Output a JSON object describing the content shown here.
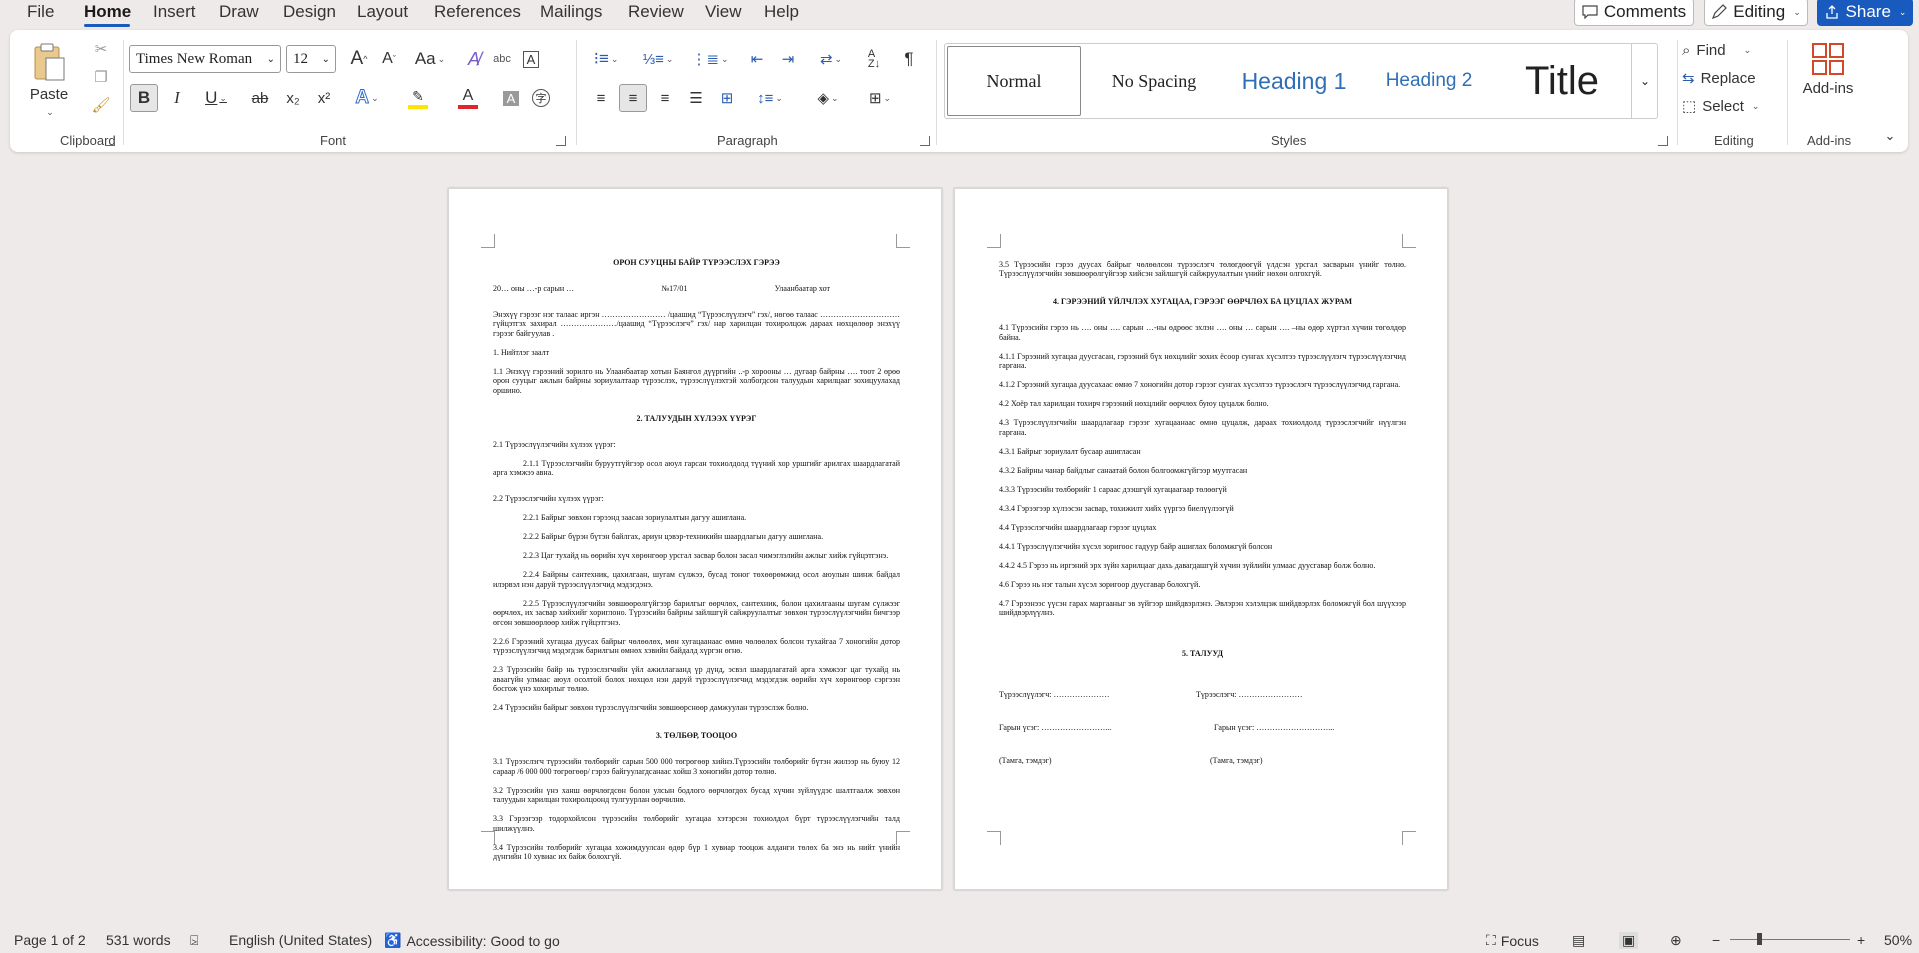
{
  "menubar": {
    "tabs": [
      "File",
      "Home",
      "Insert",
      "Draw",
      "Design",
      "Layout",
      "References",
      "Mailings",
      "Review",
      "View",
      "Help"
    ],
    "comments": "Comments",
    "editing": "Editing",
    "share": "Share"
  },
  "ribbon": {
    "clipboard": {
      "label": "Clipboard",
      "paste": "Paste"
    },
    "font": {
      "label": "Font",
      "name": "Times New Roman",
      "size": "12",
      "bold": "B",
      "italic": "I",
      "underline": "U",
      "strike": "ab",
      "sub": "x₂",
      "sup": "x²",
      "grow": "A",
      "shrink": "A",
      "case": "Aa",
      "color_a": "A"
    },
    "paragraph": {
      "label": "Paragraph"
    },
    "styles": {
      "label": "Styles",
      "items": [
        "Normal",
        "No Spacing",
        "Heading 1",
        "Heading 2",
        "Title"
      ]
    },
    "editing": {
      "label": "Editing",
      "find": "Find",
      "replace": "Replace",
      "select": "Select"
    },
    "addins": {
      "label": "Add-ins",
      "button": "Add-ins"
    }
  },
  "colors": {
    "accent": "#185abd",
    "highlight": "#ffe500",
    "font_color": "#e0252b",
    "heading": "#2f6fb6"
  },
  "page1": {
    "title": "ОРОН СУУЦНЫ БАЙР ТҮРЭЭСЛЭХ ГЭРЭЭ",
    "meta": [
      "20… оны …-р сарын …",
      "№17/01",
      "Улаанбаатар хот"
    ],
    "intro": "Энэхүү гэрээг нэг талаас иргэн …………………… /цаашид “Түрээслүүлэгч” гэх/, нөгөө талаас ………………………… гүйцэтгэх захирал …………………/цаашид “Түрээслэгч” гэх/ нар харилцан тохиролцож дараах нөхцөлөөр энэхүү гэрээг байгуулав .",
    "s1": "1. Нийтлэг заалт",
    "s1_1": "1.1   Энэхүү гэрээний зорилго нь Улаанбаатар хотын Баянгол дүүргийн ..-р хорооны … дугаар байрны …. тоот 2 өрөө орон сууцыг ажлын байрны зориулалтаар түрээслэх, түрээслүүлэхтэй холбогдсон талуудын харилцааг зохицуулахад оршино.",
    "h2": "2. ТАЛУУДЫН ХҮЛЭЭХ ҮҮРЭГ",
    "s2_1": "2.1 Түрээслүүлэгчийн хүлээх үүрэг:",
    "s2_1_1": "2.1.1   Түрээслэгчийн буруутгүйгээр осол аюул гарсан тохиолдолд түүний хор уршгийг арилгах шаардлагатай арга хэмжээ авна.",
    "s2_2": "2.2 Түрээслэгчийн хүлээх үүрэг:",
    "s2_2_1": "2.2.1 Байрыг зөвхөн гэрээнд заасан зориулалтын дагуу ашиглана.",
    "s2_2_2": "2.2.2 Байрыг бүрэн бүтэн байлгах, ариун цэвэр-техникийн шаардлагын дагуу ашиглана.",
    "s2_2_3": "2.2.3 Цаг тухайд нь өөрийн хүч хөрөнгөөр урсгал засвар болон засал чимэглэлийн ажлыг хийж гүйцэтгэнэ.",
    "s2_2_4": "2.2.4 Байрны сантехник, цахилгаан, шугам сүлжээ, бусад тоног төхөөрөмжид осол аюулын шинж байдал илэрвэл нэн даруй түрээслүүлэгчид мэдэгдэнэ.",
    "s2_2_5": "2.2.5 Түрээслүүлэгчийн зөвшөөрөлгүйгээр барилгыг өөрчлөх, сантехник, болон цахилгааны шугам сүлжээг өөрчлөх, их засвар хийхийг хориглоно. Түрээсийн байрны зайлшгүй сайжруулалтыг зөвхөн түрээслүүлэгчийн бичгээр өгсөн зөвшөөрлөөр хийж гүйцэтгэнэ.",
    "s2_2_6": "2.2.6 Гэрээний хугацаа дуусах байрыг чөлөөлөх, мөн хугацаанаас өмнө чөлөөлөх болсон тухайгаа 7 хоногийн дотор түрээслүүлэгчид мэдэгдэж барилгын өмнөх хэвийн байдалд хүргэн өгнө.",
    "s2_3": "2.3 Түрээсийн байр нь түрээслэгчийн үйл ажиллагаанд үр дүнд, эсвэл шаардлагатай арга хэмжээг цаг тухайд нь аваагүйн улмаас аюул осолтой болох нөхцөл нэн даруй түрээслүүлэгчид мэдэгдэж өөрийн хүч хөрөнгөөр сэргээн босгож үнэ хохирлыг төлнө.",
    "s2_4": "2.4 Түрээсийн байрыг зөвхөн түрээслүүлэгчийн зөвшөөрснөөр дамжуулан түрээслэж болно.",
    "h3": "3. ТӨЛБӨР, ТООЦОО",
    "s3_1": "3.1 Түрээслэгч түрээсийн төлбөрийг сарын 500 000 төгрөгөөр хийнэ.Түрээсийн төлбөрийг бүтэн жилээр нь буюу 12 сараар /6 000 000 төгрөгөөр/ гэрээ байгуулагдсанаас хойш 3 хоногийн  дотор төлнө.",
    "s3_2": "3.2 Түрээсийн үнэ ханш өөрчлөгдсөн болон улсын бодлого өөрчлөгдөх бусад хүчин зүйлүүдэс шалтгаалж зөвхөн талуудын харилцан тохиролцоонд тулгуурлан өөрчилнө.",
    "s3_3": "3.3 Гэрээгээр тодорхойлсон түрээсийн төлбөрийг хугацаа хэтэрсэн тохиолдол бүрт түрээслүүлэгчийн талд шилжүүлнэ.",
    "s3_4": "3.4 Түрээсийн төлбөрийг хугацаа хожимдуулсан өдөр бүр 1 хувиар тооцож алданги төлөх ба энэ нь нийт үнийн дүнгийн 10 хувиас их байж болохгүй."
  },
  "page2": {
    "s3_5": "3.5 Түрээсийн гэрээ дуусах байрыг чөлөөлсөн түрээслэгч төлөгдөөгүй үлдсэн урсгал засварын үнийг төлнө. Түрээслүүлэгчийн зөвшөөрөлгүйгээр хийсэн зайлшгүй сайжруулалтын үнийг нөхөн олгохгүй.",
    "h4": "4. ГЭРЭЭНИЙ ҮЙЛЧЛЭХ ХУГАЦАА, ГЭРЭЭГ ӨӨРЧЛӨХ БА ЦУЦЛАХ ЖУРАМ",
    "s4_1": "4.1 Түрээсийн гэрээ нь …. оны …. сарын …-ны өдрөөс эхлэн …. оны … сарын …. –ны өдөр хүртэл хүчин төгөлдөр байна.",
    "s4_1_1": "4.1.1 Гэрээний хугацаа дуусгасан, гэрээний бүх нөхцлийг зохих ёсоор сунгах хүсэлтээ түрээслүүлэгч түрээслүүлэгчид гаргана.",
    "s4_1_2": "4.1.2 Гэрээний хугацаа дуусахаас өмнө 7 хоногийн дотор гэрээг сунгах хүсэлтээ түрээслэгч түрээслүүлэгчид гаргана.",
    "s4_2": "4.2 Хоёр тал харилцан тохирч гэрээний нөхцлийг өөрчлөх буюу цуцалж болно.",
    "s4_3": "4.3 Түрээслүүлэгчийн шаардлагаар гэрээг хугацаанаас өмнө цуцалж, дараах тохиолдолд түрээслэгчийг нүүлгэн гаргана.",
    "s4_3_1": "4.3.1 Байрыг зориулалт бусаар ашигласан",
    "s4_3_2": "4.3.2 Байрны чанар байдлыг санаатай болон болгоомжгүйгээр муутгасан",
    "s4_3_3": "4.3.3 Түрээсийн төлбөрийг 1 сараас дээшгүй хугацаагаар төлөөгүй",
    "s4_3_4": "4.3.4 Гэрээгээр хүлээсэн засвар, тохижилт хийх үүргээ биелүүлээгүй",
    "s4_4": "4.4 Түрээслэгчийн шаардлагаар гэрээг цуцлах",
    "s4_4_1": "4.4.1 Түрээслүүлэгчийн хүсэл зоригоос гадуур байр ашиглах боломжгүй болсон",
    "s4_4_2": "4.4.2 4.5 Гэрээ нь иргэний эрх зүйн харилцааг дахь давагдашгүй хүчин зүйлийн улмаас дуусгавар болж болно.",
    "s4_6": "4.6 Гэрээ нь нэг талын хүсэл зоригоор дуусгавар болохгүй.",
    "s4_7": "4.7 Гэрээнээс үүсэн гарах маргааныг эв зүйгээр шийдвэрлэнэ. Эвлэрэн хэлэлцэж шийдвэрлэх боломжгүй бол шүүхээр шийдвэрлүүлнэ.",
    "h5": "5. ТАЛУУД",
    "sig_l": [
      "Түрээслүүлэгч: …………………",
      "Гарын үсэг: ……………………...",
      "(Тамга, тэмдэг)"
    ],
    "sig_r": [
      "Түрээслэгч: ……………………",
      "Гарын үсэг: ………………………...",
      "(Тамга, тэмдэг)"
    ]
  },
  "status": {
    "page": "Page 1 of 2",
    "words": "531 words",
    "language": "English (United States)",
    "accessibility": "Accessibility: Good to go",
    "focus": "Focus",
    "zoom": "50%"
  }
}
